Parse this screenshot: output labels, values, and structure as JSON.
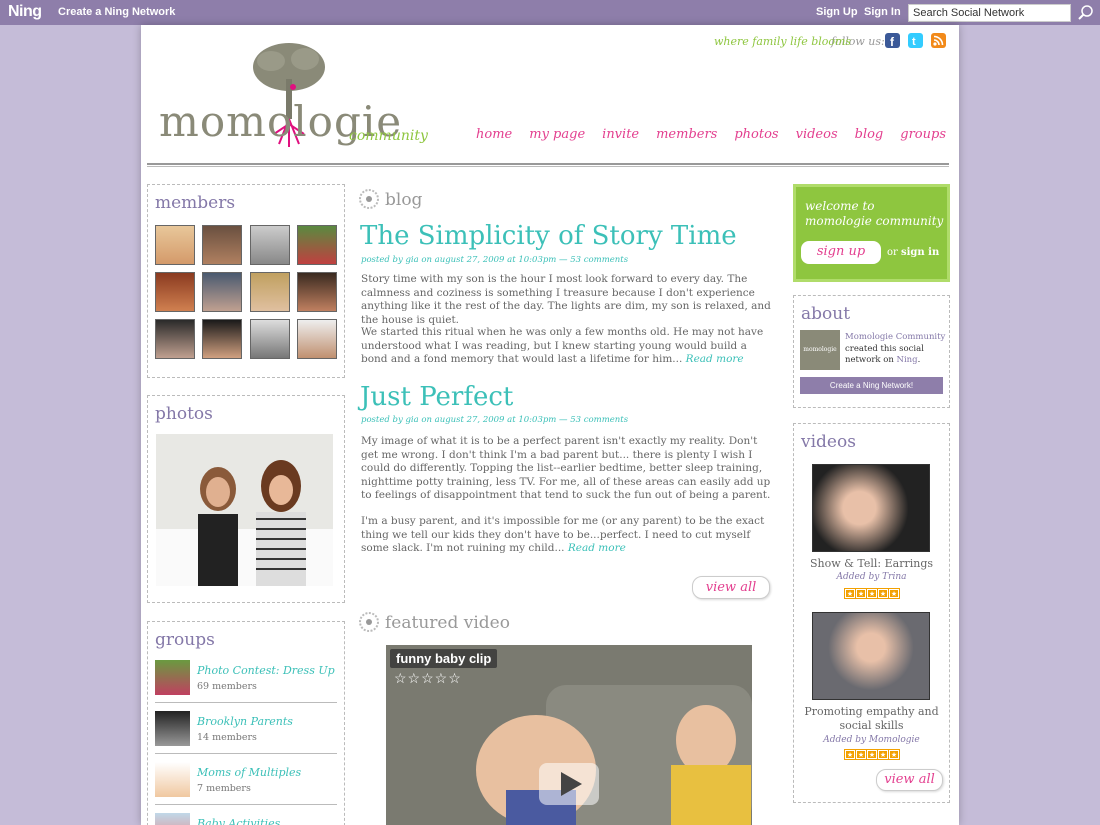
{
  "ningbar": {
    "logo": "Ning",
    "create": "Create a Ning Network",
    "signup": "Sign Up",
    "signin": "Sign In",
    "search_value": "Search Social Network"
  },
  "header": {
    "tagline": "where family life blooms",
    "follow": "follow us:",
    "brand": "momologie",
    "brand_sub": "community"
  },
  "nav": [
    "home",
    "my page",
    "invite",
    "members",
    "photos",
    "videos",
    "blog",
    "groups"
  ],
  "members": {
    "title": "members"
  },
  "photos": {
    "title": "photos"
  },
  "groups": {
    "title": "groups",
    "items": [
      {
        "name": "Photo Contest: Dress Up",
        "members": "69 members"
      },
      {
        "name": "Brooklyn Parents",
        "members": "14 members"
      },
      {
        "name": "Moms of Multiples",
        "members": "7 members"
      },
      {
        "name": "Baby Activities",
        "members": ""
      }
    ]
  },
  "blog": {
    "title": "blog",
    "posts": [
      {
        "title": "The Simplicity of Story Time",
        "meta": "posted by gia on august 27, 2009 at 10:03pm — 53 comments",
        "p1": "Story time with my son is the hour I most look forward to every day.  The calmness and coziness is something I treasure because I don't experience anything like it the rest of the day.  The lights are dim, my son is relaxed, and the house is quiet.",
        "p2": "We started this ritual when he was only a few months old.  He may not have understood what I was reading, but I knew starting young would build a bond and a fond memory that would last a lifetime for him...",
        "more": "Read more"
      },
      {
        "title": "Just Perfect",
        "meta": "posted by gia on august 27, 2009 at 10:03pm — 53 comments",
        "p1": "My image of what it is to be a perfect parent isn't exactly my reality.  Don't get me wrong.  I don't think I'm a bad parent but... there is plenty I wish I could do differently.  Topping the list--earlier bedtime, better sleep training, nighttime potty training, less TV.  For me, all of these areas can easily add up to feelings of disappointment that tend to suck the fun out of being a parent.",
        "p2": "I'm a busy parent, and it's impossible for me (or any parent) to be the exact thing we tell our kids they don't have to be...perfect.  I need to cut myself some slack.  I'm not ruining my child...",
        "more": "Read more"
      }
    ],
    "view_all": "view all"
  },
  "featured": {
    "title": "featured video",
    "clip": "funny baby clip"
  },
  "welcome": {
    "text": "welcome to momologie community",
    "signup": "sign up",
    "or": "or",
    "signin": "sign in"
  },
  "about": {
    "title": "about",
    "name": "Momologie Community",
    "text": "created this social network on",
    "ning": "Ning",
    "button": "Create a Ning Network!",
    "logo_text": "momologie"
  },
  "videos": {
    "title": "videos",
    "items": [
      {
        "title": "Show & Tell: Earrings",
        "by": "Added by Trina"
      },
      {
        "title": "Promoting empathy and social skills",
        "by": "Added by Momologie"
      }
    ],
    "view_all": "view all"
  },
  "colors": {
    "purple": "#8e7eaa",
    "pink": "#e33f8f",
    "teal": "#3cc0b8",
    "green": "#8ec63f"
  }
}
